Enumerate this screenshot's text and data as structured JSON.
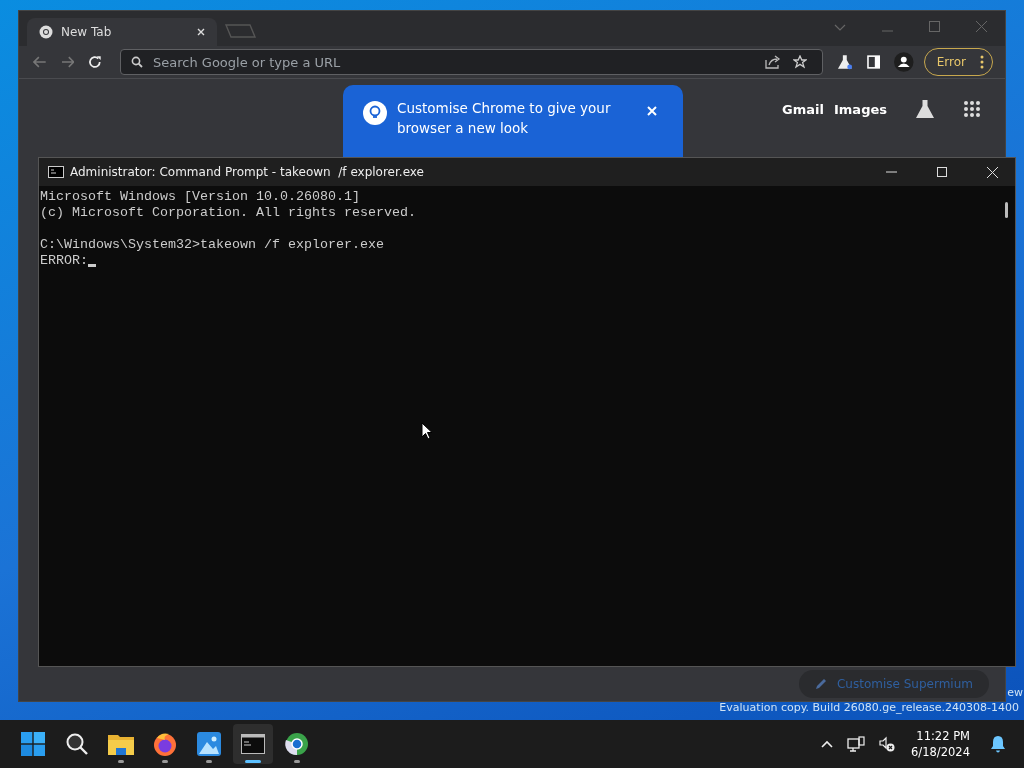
{
  "desktop": {
    "watermark": [
      "ew",
      "Evaluation copy. Build 26080.ge_release.240308-1400"
    ]
  },
  "browser": {
    "tab": {
      "title": "New Tab"
    },
    "address": {
      "placeholder": "Search Google or type a URL"
    },
    "profile_button": "Error",
    "promo": {
      "text": "Customise Chrome to give your browser a new look"
    },
    "links": [
      "Gmail",
      "Images"
    ],
    "customise_button": "Customise Supermium"
  },
  "terminal": {
    "title": "Administrator: Command Prompt - takeown  /f explorer.exe",
    "output": [
      "Microsoft Windows [Version 10.0.26080.1]",
      "(c) Microsoft Corporation. All rights reserved."
    ],
    "command": "C:\\Windows\\System32>takeown /f explorer.exe",
    "error": "ERROR:"
  },
  "taskbar": {
    "apps": [
      {
        "kind": "start",
        "running": false,
        "selected": false
      },
      {
        "kind": "search",
        "running": false,
        "selected": false
      },
      {
        "kind": "files",
        "running": true,
        "selected": false
      },
      {
        "kind": "firefox",
        "running": true,
        "selected": false
      },
      {
        "kind": "photos",
        "running": true,
        "selected": false
      },
      {
        "kind": "terminal",
        "running": true,
        "selected": true
      },
      {
        "kind": "browser",
        "running": true,
        "selected": false
      }
    ],
    "clock": {
      "time": "11:22 PM",
      "date": "6/18/2024"
    }
  }
}
